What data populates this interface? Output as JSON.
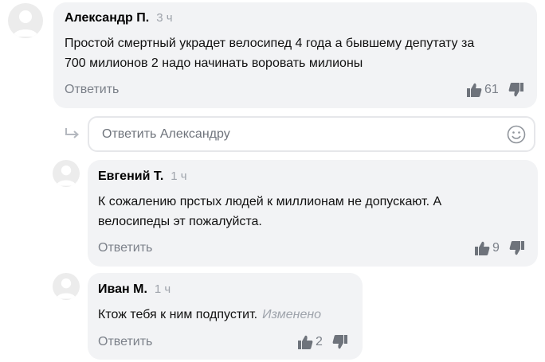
{
  "comments": [
    {
      "author": "Александр П.",
      "time": "3 ч",
      "lines": [
        "Простой смертный украдет велосипед 4 года а бывшему депутату за",
        "700 милионов 2 надо начинать воровать милионы"
      ],
      "edited": "",
      "reply_label": "Ответить",
      "likes": "61"
    },
    {
      "author": "Евгений Т.",
      "time": "1 ч",
      "lines": [
        "К сожалению прстых людей к миллионам не допускают. А",
        "велосипеды эт пожалуйста."
      ],
      "edited": "",
      "reply_label": "Ответить",
      "likes": "9"
    },
    {
      "author": "Иван М.",
      "time": "1 ч",
      "lines": [
        "Ктож тебя к ним подпустит."
      ],
      "edited": "Изменено",
      "reply_label": "Ответить",
      "likes": "2"
    }
  ],
  "reply_box": {
    "placeholder": "Ответить Александру",
    "value": ""
  },
  "icons": {
    "avatar": "user-avatar-icon",
    "like": "thumb-up-icon",
    "dislike": "thumb-down-icon",
    "reply_arrow": "reply-arrow-icon",
    "emoji": "smiley-icon"
  },
  "colors": {
    "bubble": "#f2f3f5",
    "muted": "#9ea3ab",
    "icon": "#6e737b"
  }
}
